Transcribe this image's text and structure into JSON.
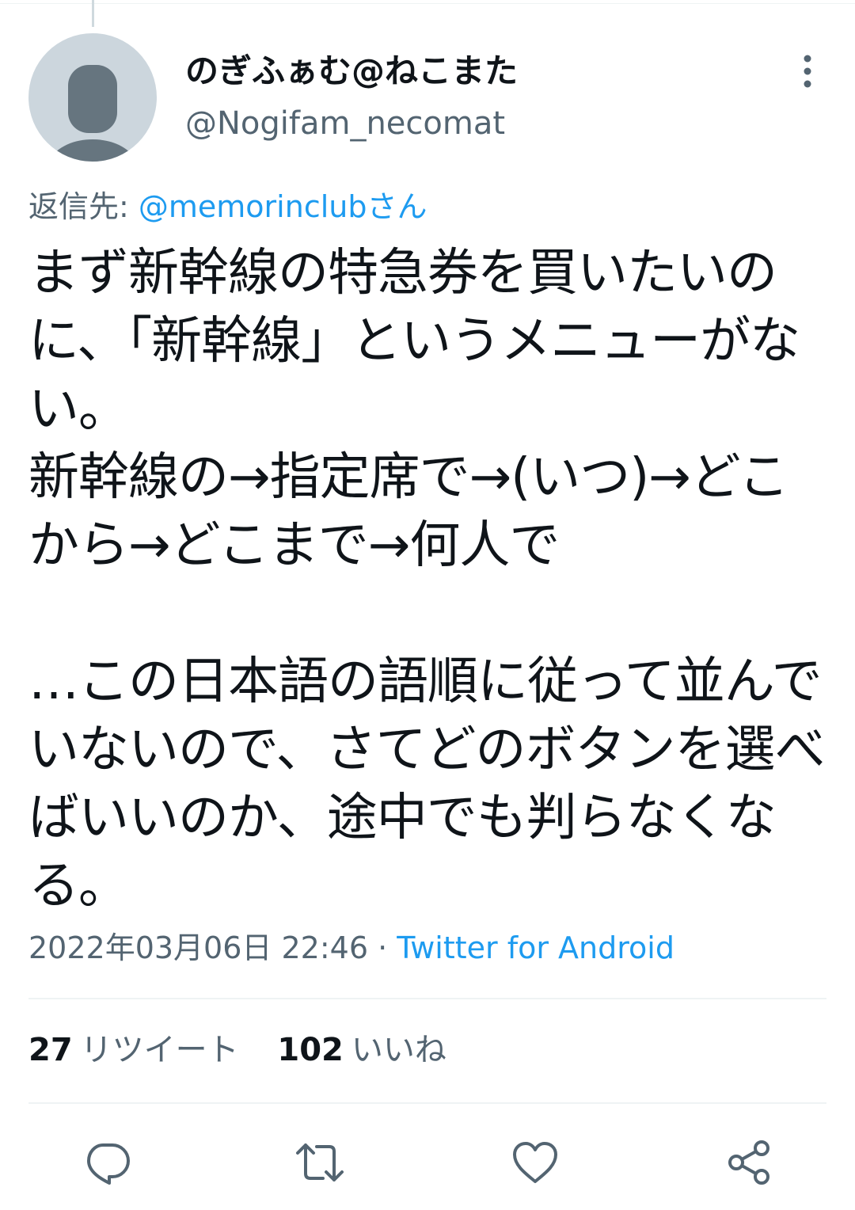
{
  "tweet": {
    "display_name": "のぎふぁむ@ねこまた",
    "username": "@Nogifam_necomat",
    "reply_prefix": "返信先: ",
    "reply_mention": "@memorinclubさん",
    "text": "まず新幹線の特急券を買いたいのに、「新幹線」というメニューがない。\n新幹線の→指定席で→(いつ)→どこから→どこまで→何人で\n\n…この日本語の語順に従って並んでいないので、さてどのボタンを選べばいいのか、途中でも判らなくなる。",
    "timestamp": "2022年03月06日 22:46",
    "separator": " · ",
    "source": "Twitter for Android"
  },
  "stats": {
    "retweets_count": "27",
    "retweets_label": "リツイート",
    "likes_count": "102",
    "likes_label": "いいね"
  },
  "icons": {
    "avatar": "default-profile-icon",
    "more": "more-vertical-icon",
    "reply": "reply-icon",
    "retweet": "retweet-icon",
    "like": "heart-icon",
    "share": "share-icon"
  },
  "colors": {
    "text": "#0f1419",
    "secondary": "#536471",
    "link": "#1d9bf0",
    "avatar_bg": "#ccd6dd",
    "avatar_figure": "#66757f",
    "divider": "#eff3f4"
  }
}
